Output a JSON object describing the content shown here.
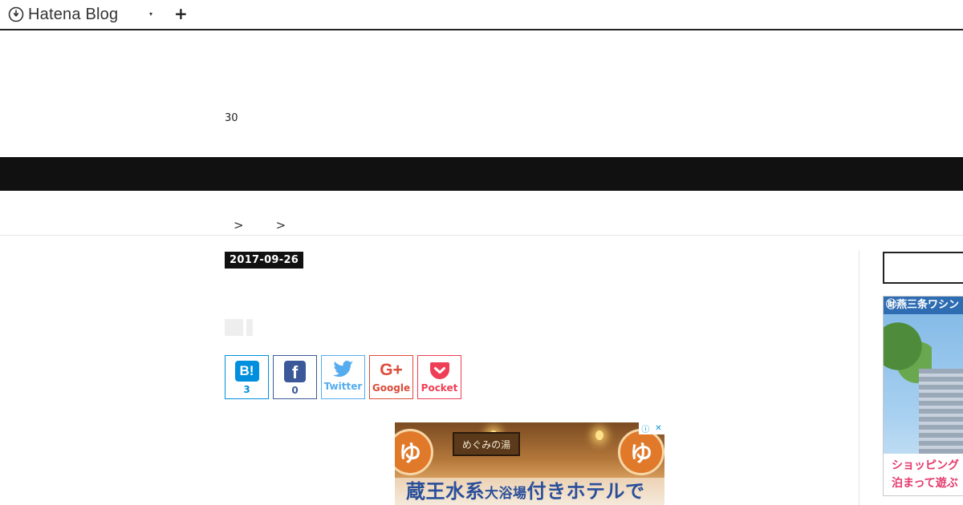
{
  "topbar": {
    "logo_text": "Hatena Blog",
    "caret": "▾",
    "plus": "+"
  },
  "header": {
    "number": "30"
  },
  "breadcrumb": {
    "sep1": ">",
    "sep2": ">"
  },
  "article": {
    "date": "2017-09-26"
  },
  "share": {
    "hatena": {
      "icon": "B!",
      "count": "3"
    },
    "facebook": {
      "icon": "f",
      "count": "0"
    },
    "twitter": {
      "label": "Twitter"
    },
    "google": {
      "icon": "G+",
      "label": "Google"
    },
    "pocket": {
      "label": "Pocket"
    }
  },
  "ad_main": {
    "sign": "めぐみの湯",
    "yu_mark": "ゆ",
    "headline_a": "蔵王水系",
    "headline_b": "大浴場",
    "headline_c": "付きホテルで",
    "adchoices_info": "ⓘ",
    "adchoices_close": "✕"
  },
  "ad_side": {
    "top": "㊖燕三条ワシン",
    "line1": "ショッピング",
    "line2": "泊まって遊ぶ"
  },
  "colors": {
    "hatena": "#008fde",
    "facebook": "#3b5998",
    "twitter": "#55acee",
    "google": "#dd4b39",
    "pocket": "#ef3f56"
  }
}
